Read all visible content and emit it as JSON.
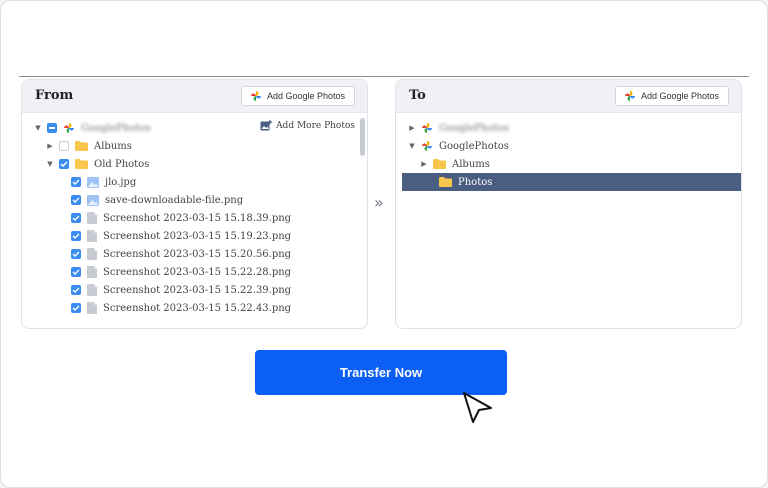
{
  "from_panel": {
    "title": "From",
    "add_button_label": "Add Google Photos",
    "add_more_label": "Add More Photos",
    "account_name": "GooglePhotos",
    "items": [
      {
        "label": "Albums"
      },
      {
        "label": "Old Photos"
      },
      {
        "label": "jlo.jpg"
      },
      {
        "label": "save-downloadable-file.png"
      },
      {
        "label": "Screenshot 2023-03-15 15.18.39.png"
      },
      {
        "label": "Screenshot 2023-03-15 15.19.23.png"
      },
      {
        "label": "Screenshot 2023-03-15 15.20.56.png"
      },
      {
        "label": "Screenshot 2023-03-15 15.22.28.png"
      },
      {
        "label": "Screenshot 2023-03-15 15.22.39.png"
      },
      {
        "label": "Screenshot 2023-03-15 15.22.43.png"
      }
    ]
  },
  "to_panel": {
    "title": "To",
    "add_button_label": "Add Google Photos",
    "account_1": "GooglePhotos",
    "account_2": "GooglePhotos",
    "albums_label": "Albums",
    "selected_label": "Photos"
  },
  "transfer_button_label": "Transfer Now",
  "colors": {
    "accent": "#0b5ff4",
    "checkbox": "#3b8bf0",
    "selected_row": "#4a5e82",
    "folder": "#f7c64a"
  }
}
